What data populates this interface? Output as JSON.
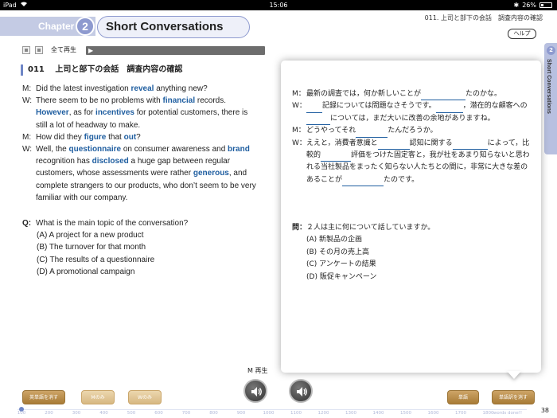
{
  "status_bar": {
    "carrier": "iPad",
    "time": "15:06",
    "battery": "26%"
  },
  "header": {
    "chapter_label": "Chapter",
    "chapter_number": "2",
    "title": "Short Conversations",
    "breadcrumb": "011. 上司と部下の会話　調査内容の確認",
    "help_button": "ヘルプ"
  },
  "audio": {
    "play_all_label": "全て再生",
    "play_symbol": "▶"
  },
  "section": {
    "number": "011",
    "title": "上司と部下の会話　調査内容の確認"
  },
  "conversation_en": [
    {
      "speaker": "M:",
      "parts": [
        [
          "Did the latest investigation ",
          false
        ],
        [
          "reveal",
          true
        ],
        [
          " anything new?",
          false
        ]
      ]
    },
    {
      "speaker": "W:",
      "parts": [
        [
          "There seem to be no problems with ",
          false
        ],
        [
          "financial",
          true
        ],
        [
          " records. ",
          false
        ],
        [
          "However",
          true
        ],
        [
          ", as for ",
          false
        ],
        [
          "incentives",
          true
        ],
        [
          " for potential customers, there is still a lot of headway to make.",
          false
        ]
      ]
    },
    {
      "speaker": "M:",
      "parts": [
        [
          "How did they ",
          false
        ],
        [
          "figure",
          true
        ],
        [
          " that ",
          false
        ],
        [
          "out",
          true
        ],
        [
          "?",
          false
        ]
      ]
    },
    {
      "speaker": "W:",
      "parts": [
        [
          "Well, the ",
          false
        ],
        [
          "questionnaire",
          true
        ],
        [
          " on consumer awareness and ",
          false
        ],
        [
          "brand",
          true
        ],
        [
          " recognition has ",
          false
        ],
        [
          "disclosed",
          true
        ],
        [
          " a huge gap between regular customers, whose assessments were rather ",
          false
        ],
        [
          "generous",
          true
        ],
        [
          ", and complete strangers to our products, who don’t seem to be very familiar with our company.",
          false
        ]
      ]
    }
  ],
  "question_en": {
    "label": "Q:",
    "text": "What is the main topic of the conversation?",
    "options": [
      "(A)  A project for a new product",
      "(B)  The turnover for that month",
      "(C)  The results of a questionnaire",
      "(D)  A promotional campaign"
    ]
  },
  "conversation_jp": [
    {
      "speaker": "M：",
      "parts": [
        [
          "最新の調査では，何か新しいことが",
          "t"
        ],
        [
          "",
          "b",
          56
        ],
        [
          "たのかな。",
          "t"
        ]
      ]
    },
    {
      "speaker": "W：",
      "parts": [
        [
          "",
          "b",
          20
        ],
        [
          "記録については問題なさそうです。",
          "t"
        ],
        [
          "",
          "b",
          34
        ],
        [
          "，潜在的な顧客への",
          "t"
        ],
        [
          "",
          "b",
          30
        ],
        [
          "については，まだ大いに改善の余地があります",
          "t"
        ],
        [
          "ね。",
          "t"
        ]
      ]
    },
    {
      "speaker": "M：",
      "parts": [
        [
          "どうやってそれ",
          "t"
        ],
        [
          "",
          "b",
          40
        ],
        [
          "たんだろうか。",
          "t"
        ]
      ]
    },
    {
      "speaker": "W：",
      "parts": [
        [
          "ええと，消費者意識と",
          "t"
        ],
        [
          "",
          "b",
          40
        ],
        [
          "認知に関する",
          "t"
        ],
        [
          "",
          "b",
          44
        ],
        [
          "によって，比較的",
          "t"
        ],
        [
          "",
          "b",
          38
        ],
        [
          "評価をつけた固定客と，我が社をあまり知らないと思われる当社製品をまったく知らない人たちとの間に，非常に大きな差のあることが",
          "t"
        ],
        [
          "",
          "b",
          52
        ],
        [
          "たのです。",
          "t"
        ]
      ]
    }
  ],
  "question_jp": {
    "label": "問：",
    "text": "２人は主に何について話していますか。",
    "options": [
      "(A)  新製品の企画",
      "(B)  その月の売上高",
      "(C)  アンケートの結果",
      "(D)  販促キャンペーン"
    ]
  },
  "side_tab": {
    "number": "2",
    "label": "Short Conversations"
  },
  "bottom": {
    "m_play_label": "M 再生",
    "buttons": {
      "hide_english": "英単語を消す",
      "m_only": "Mのみ",
      "w_only": "Wのみ",
      "vocab": "単語",
      "hide_vocab_translation": "単語訳を消す"
    },
    "scale": [
      "100",
      "200",
      "300",
      "400",
      "500",
      "600",
      "700",
      "800",
      "900",
      "1000",
      "1100",
      "1200",
      "1300",
      "1400",
      "1500",
      "1600",
      "1700",
      "1800"
    ],
    "scale_caption": "words done!!",
    "page_number": "38"
  }
}
